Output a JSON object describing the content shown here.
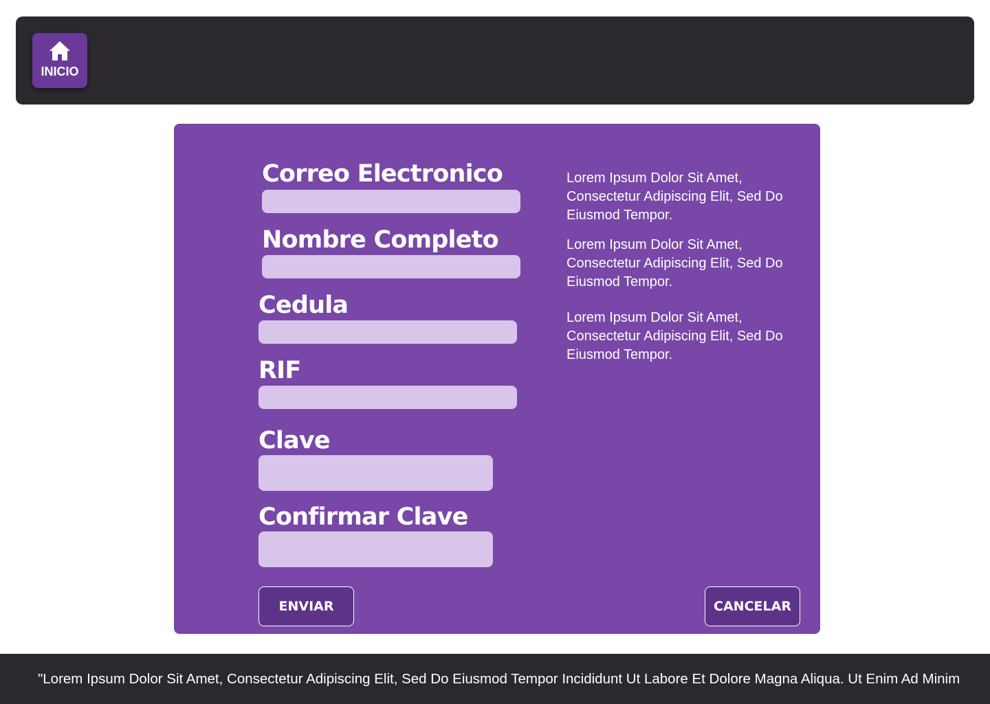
{
  "header": {
    "home_button": {
      "label": "INICIO",
      "icon": "home-icon"
    }
  },
  "form": {
    "fields": [
      {
        "label": "Correo Electronico",
        "value": "",
        "placeholder": ""
      },
      {
        "label": "Nombre Completo",
        "value": "",
        "placeholder": ""
      },
      {
        "label": "Cedula",
        "value": "",
        "placeholder": ""
      },
      {
        "label": "RIF",
        "value": "",
        "placeholder": ""
      },
      {
        "label": "Clave",
        "value": "",
        "placeholder": ""
      },
      {
        "label": "Confirmar Clave",
        "value": "",
        "placeholder": ""
      }
    ],
    "descriptions": [
      "Lorem Ipsum Dolor Sit Amet, Consectetur Adipiscing Elit, Sed Do Eiusmod Tempor.",
      "Lorem Ipsum Dolor Sit Amet, Consectetur Adipiscing Elit, Sed Do Eiusmod Tempor.",
      "Lorem Ipsum Dolor Sit Amet, Consectetur Adipiscing Elit, Sed Do Eiusmod Tempor."
    ],
    "submit_label": "ENVIAR",
    "cancel_label": "CANCELAR"
  },
  "footer": {
    "text": "\"Lorem Ipsum Dolor Sit Amet, Consectetur Adipiscing Elit, Sed Do Eiusmod Tempor Incididunt Ut Labore Et Dolore Magna Aliqua. Ut Enim Ad Minim"
  },
  "colors": {
    "header_bg": "#2b282e",
    "card_bg": "#7847a7",
    "input_bg": "#d9c5ea",
    "button_bg": "#5c3389",
    "home_button_bg": "#6a3a98",
    "text": "#ffffff"
  }
}
